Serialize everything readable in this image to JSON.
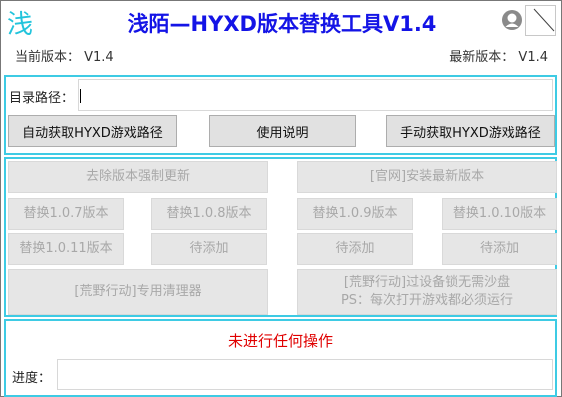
{
  "window": {
    "logo_char": "浅",
    "title": "浅陌—HYXD版本替换工具V1.4",
    "current_version_label": "当前版本： V1.4",
    "latest_version_label": "最新版本： V1.4",
    "icons": [
      "person-icon",
      "close-icon"
    ]
  },
  "path_panel": {
    "dir_label": "目录路径：",
    "dir_value": "",
    "auto_button": "自动获取HYXD游戏路径",
    "help_button": "使用说明",
    "manual_button": "手动获取HYXD游戏路径"
  },
  "actions": {
    "remove_update": "去除版本强制更新",
    "install_latest": "[官网]安装最新版本",
    "replace_107": "替换1.0.7版本",
    "replace_108": "替换1.0.8版本",
    "replace_109": "替换1.0.9版本",
    "replace_1010": "替换1.0.10版本",
    "replace_1011": "替换1.0.11版本",
    "pending_1": "待添加",
    "pending_2": "待添加",
    "pending_3": "待添加",
    "cleaner": "[荒野行动]专用清理器",
    "sandbox_line1": "[荒野行动]过设备锁无需沙盘",
    "sandbox_line2": "PS：每次打开游戏都必须运行"
  },
  "status_panel": {
    "status_text": "未进行任何操作",
    "progress_label": "进度：",
    "progress_value": 0
  },
  "colors": {
    "title": "#1414e6",
    "panel_border": "#3ecbe4",
    "status": "#e00000",
    "logo": "#22c4dc"
  }
}
